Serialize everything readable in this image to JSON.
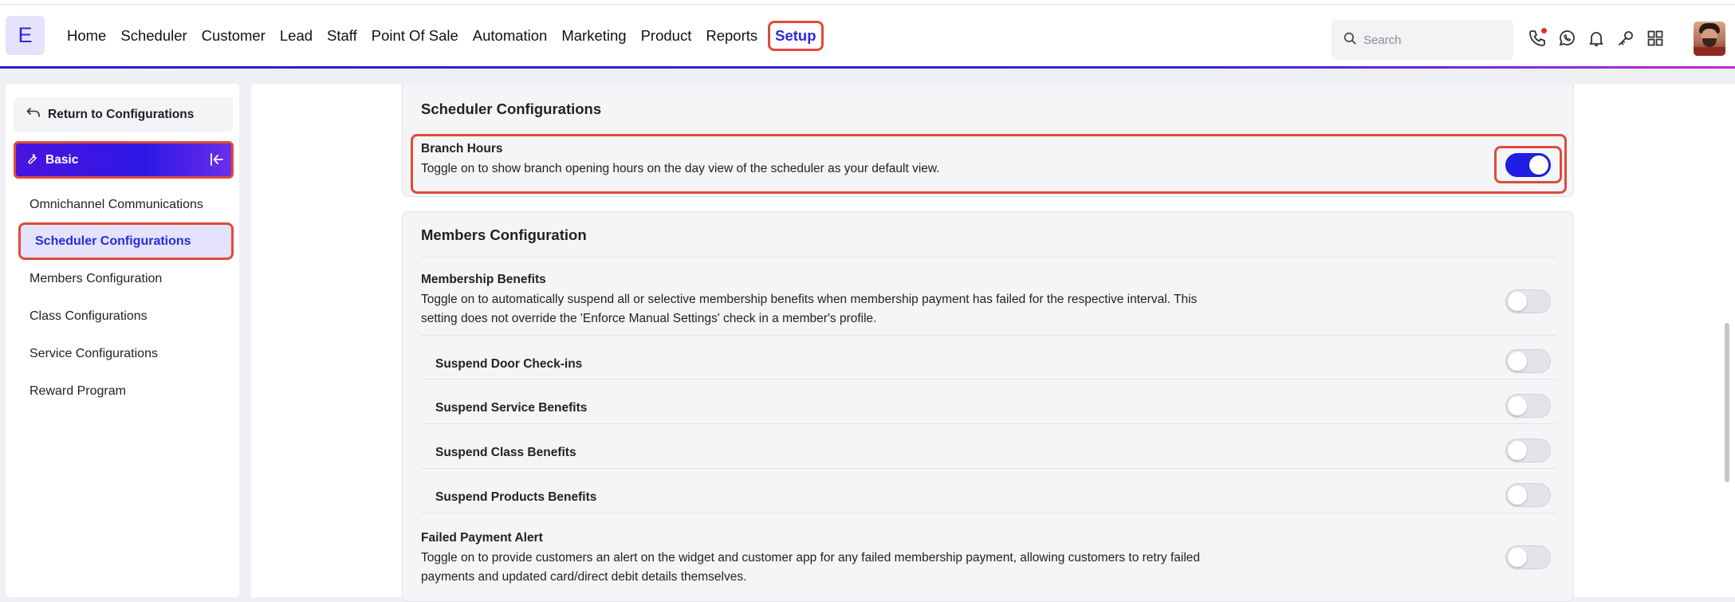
{
  "app": {
    "logo_letter": "E",
    "brand_color": "#3326d3",
    "highlight_color": "#e04a3a"
  },
  "nav": {
    "items": [
      {
        "label": "Home",
        "active": false
      },
      {
        "label": "Scheduler",
        "active": false
      },
      {
        "label": "Customer",
        "active": false
      },
      {
        "label": "Lead",
        "active": false
      },
      {
        "label": "Staff",
        "active": false
      },
      {
        "label": "Point Of Sale",
        "active": false
      },
      {
        "label": "Automation",
        "active": false
      },
      {
        "label": "Marketing",
        "active": false
      },
      {
        "label": "Product",
        "active": false
      },
      {
        "label": "Reports",
        "active": false
      },
      {
        "label": "Setup",
        "active": true
      }
    ],
    "search_placeholder": "Search",
    "icons": [
      "phone-icon",
      "whatsapp-icon",
      "bell-icon",
      "key-icon",
      "apps-grid-icon"
    ]
  },
  "sidebar": {
    "return_label": "Return to Configurations",
    "section_label": "Basic",
    "items": [
      {
        "label": "Omnichannel Communications",
        "active": false
      },
      {
        "label": "Scheduler Configurations",
        "active": true
      },
      {
        "label": "Members Configuration",
        "active": false
      },
      {
        "label": "Class Configurations",
        "active": false
      },
      {
        "label": "Service Configurations",
        "active": false
      },
      {
        "label": "Reward Program",
        "active": false
      }
    ]
  },
  "scheduler_config": {
    "title": "Scheduler Configurations",
    "branch_hours": {
      "title": "Branch Hours",
      "description": "Toggle on to show branch opening hours on the day view of the scheduler as your default view.",
      "enabled": true
    }
  },
  "members_config": {
    "title": "Members Configuration",
    "membership_benefits": {
      "title": "Membership Benefits",
      "description_line1": "Toggle on to automatically suspend all or selective membership benefits when membership payment has failed for the respective interval. This",
      "description_line2": "setting does not override the 'Enforce Manual Settings' check in a member's profile.",
      "enabled": false
    },
    "sub_settings": [
      {
        "label": "Suspend Door Check-ins",
        "enabled": false
      },
      {
        "label": "Suspend Service Benefits",
        "enabled": false
      },
      {
        "label": "Suspend Class Benefits",
        "enabled": false
      },
      {
        "label": "Suspend Products Benefits",
        "enabled": false
      }
    ],
    "failed_payment_alert": {
      "title": "Failed Payment Alert",
      "description_line1": "Toggle on to provide customers an alert on the widget and customer app for any failed membership payment, allowing customers to retry failed",
      "description_line2": "payments and updated card/direct debit details themselves.",
      "enabled": false
    }
  }
}
